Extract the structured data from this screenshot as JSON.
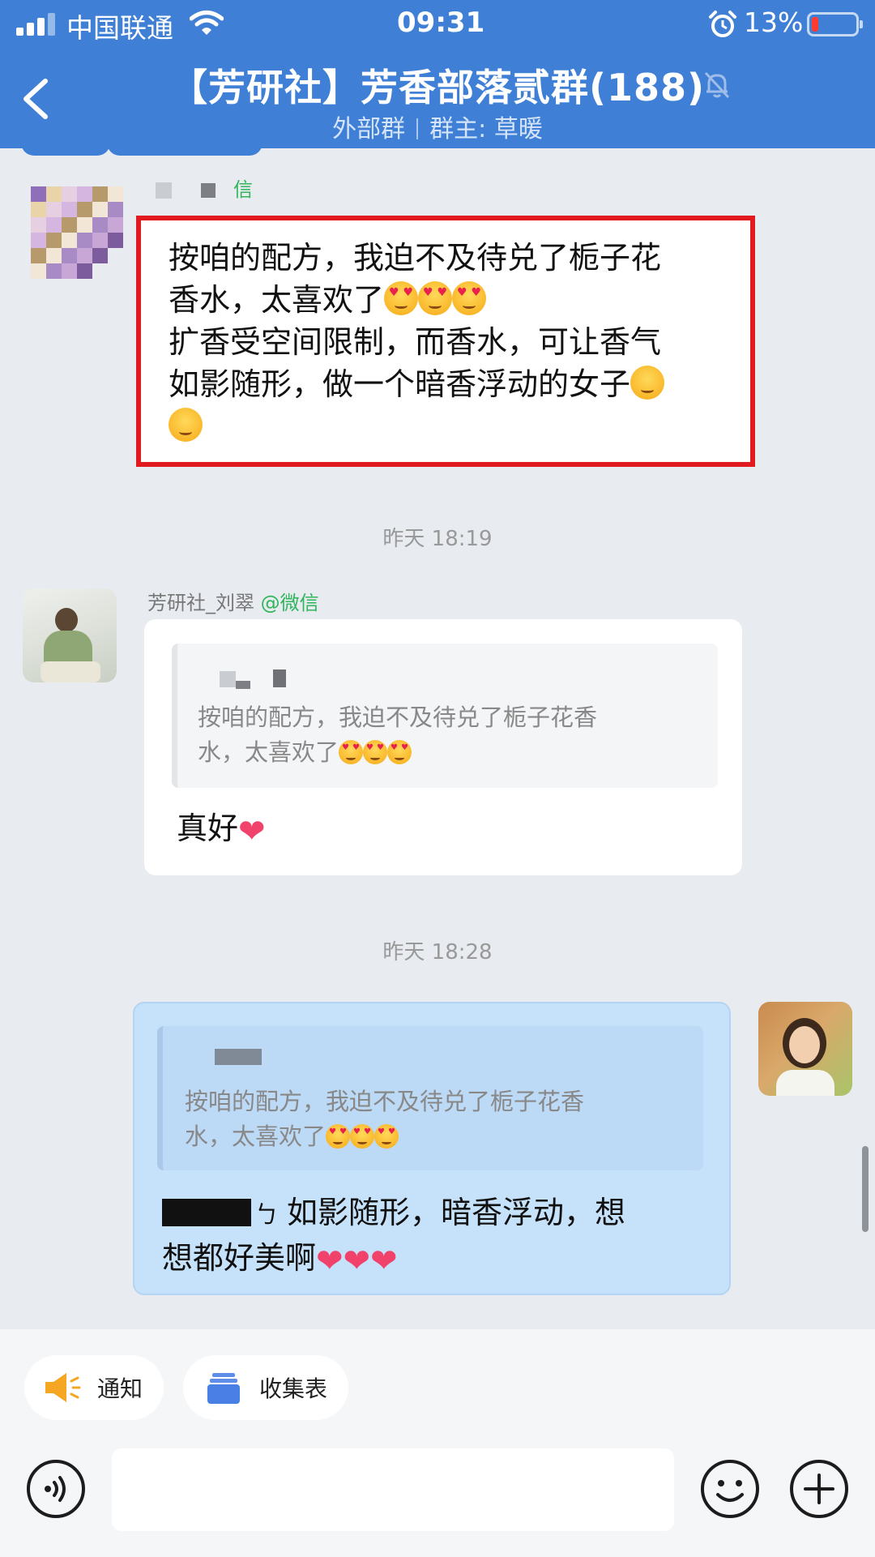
{
  "status_bar": {
    "carrier": "中国联通",
    "time": "09:31",
    "battery": "13%"
  },
  "header": {
    "title": "【芳研社】芳香部落贰群(188)",
    "tag": "外部群",
    "owner": "群主: 草暖",
    "icons": [
      "back-icon",
      "mute-bell-icon"
    ]
  },
  "messages": {
    "first": {
      "sender_suffix": "信",
      "lines": [
        "按咱的配方，我迫不及待兑了栀子花",
        "香水，太喜欢了",
        "扩香受空间限制，而香水，可让香气",
        "如影随形，做一个暗香浮动的女子"
      ]
    },
    "time1": "昨天 18:19",
    "second": {
      "sender": "芳研社_刘翠",
      "sender_source": "@微信",
      "quote_lines": [
        "按咱的配方，我迫不及待兑了栀子花香",
        "水，太喜欢了"
      ],
      "reply": "真好"
    },
    "time2": "昨天 18:28",
    "third": {
      "quote_lines": [
        "按咱的配方，我迫不及待兑了栀子花香",
        "水，太喜欢了"
      ],
      "reply_line1": "如影随形，暗香浮动，想",
      "reply_line2": "想都好美啊"
    }
  },
  "bottom": {
    "chip_notice": "通知",
    "chip_form": "收集表",
    "icons": [
      "voice-icon",
      "emoji-icon",
      "plus-icon"
    ]
  }
}
